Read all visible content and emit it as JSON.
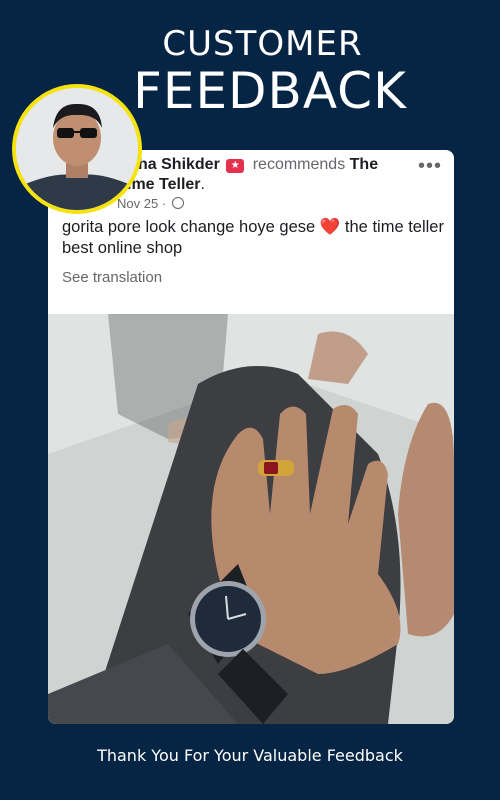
{
  "header": {
    "line1": "CUSTOMER",
    "line2": "FEEDBACK"
  },
  "post": {
    "author_name_partial": "ha Shikder",
    "badge_icon": "recommend-badge-icon",
    "recommends_text": "recommends",
    "page_name_part1": "The",
    "page_name_part2": "ime Teller",
    "page_name_end": ".",
    "date": "Nov 25",
    "separator": "·",
    "privacy_icon": "globe-icon",
    "more_icon": "more-options-icon",
    "more_glyph": "•••",
    "text_before_heart": "gorita pore look change hoye gese",
    "heart": "❤️",
    "text_after_heart": "the time teller best online shop",
    "see_translation": "See translation"
  },
  "footer": {
    "text": "Thank You For Your  Valuable Feedback"
  },
  "colors": {
    "background": "#062444",
    "avatar_ring": "#f5e20f",
    "badge": "#e4324e",
    "heart": "#e41e3f"
  }
}
